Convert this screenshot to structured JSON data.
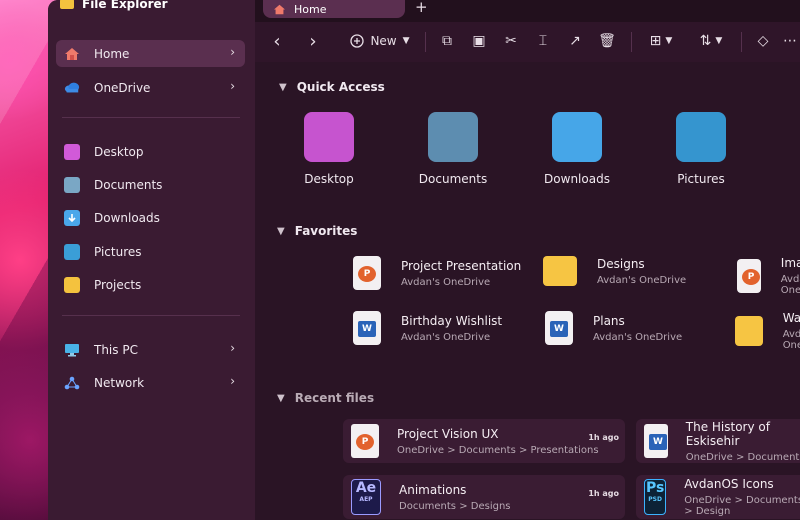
{
  "app": {
    "title": "File Explorer"
  },
  "tabs": [
    {
      "label": "Home"
    }
  ],
  "toolbar": {
    "new_label": "New"
  },
  "sidebar": {
    "items": [
      {
        "label": "Home",
        "icon": "home-icon",
        "color": "#f07a6b"
      },
      {
        "label": "OneDrive",
        "icon": "cloud-icon",
        "color": "#3d8be6"
      },
      {
        "label": "Desktop",
        "icon": "desktop-icon",
        "color": "#d15ad8"
      },
      {
        "label": "Documents",
        "icon": "document-icon",
        "color": "#7aa7c5"
      },
      {
        "label": "Downloads",
        "icon": "download-icon",
        "color": "#4aa7ea"
      },
      {
        "label": "Pictures",
        "icon": "picture-icon",
        "color": "#3a9ed7"
      },
      {
        "label": "Projects",
        "icon": "folder-icon",
        "color": "#f4c23e"
      },
      {
        "label": "This PC",
        "icon": "monitor-icon",
        "color": "#49b3e8"
      },
      {
        "label": "Network",
        "icon": "network-icon",
        "color": "#6aa3ff"
      }
    ]
  },
  "sections": {
    "quick_access": "Quick Access",
    "favorites": "Favorites",
    "recent": "Recent files"
  },
  "quick_access": [
    {
      "label": "Desktop",
      "color": "#c654cf"
    },
    {
      "label": "Documents",
      "color": "#5d8db0"
    },
    {
      "label": "Downloads",
      "color": "#46a6e8"
    },
    {
      "label": "Pictures",
      "color": "#3595cf"
    }
  ],
  "favorites": [
    {
      "name": "Project Presentation",
      "sub": "Avdan's OneDrive",
      "type": "P"
    },
    {
      "name": "Designs",
      "sub": "Avdan's OneDrive",
      "type": "folder"
    },
    {
      "name": "Imagination",
      "sub": "Avdan's OneDrive",
      "type": "P"
    },
    {
      "name": "Birthday Wishlist",
      "sub": "Avdan's OneDrive",
      "type": "W"
    },
    {
      "name": "Plans",
      "sub": "Avdan's OneDrive",
      "type": "W"
    },
    {
      "name": "Wallpapers",
      "sub": "Avdan's OneDrive",
      "type": "folder"
    }
  ],
  "recent": [
    {
      "name": "Project Vision UX",
      "path": "OneDrive > Documents > Presentations",
      "time": "1h ago",
      "type": "P"
    },
    {
      "name": "The History of Eskisehir",
      "path": "OneDrive > Documents",
      "time": "",
      "type": "W"
    },
    {
      "name": "Animations",
      "path": "Documents > Designs",
      "time": "1h ago",
      "type": "Ae",
      "badge": "AEP"
    },
    {
      "name": "AvdanOS Icons",
      "path": "OneDrive > Documents > Design",
      "time": "",
      "type": "Ps",
      "badge": "PSD"
    }
  ]
}
